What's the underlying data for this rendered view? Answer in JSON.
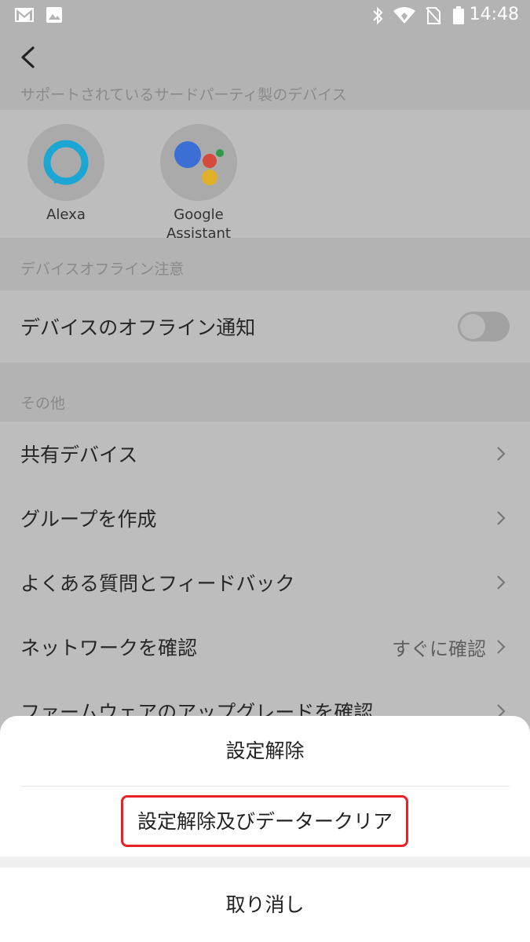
{
  "status_bar": {
    "time": "14:48",
    "left_icons": [
      "gmail-icon",
      "image-icon"
    ],
    "right_icons": [
      "bluetooth-icon",
      "wifi-icon",
      "no-sim-icon",
      "battery-icon"
    ]
  },
  "sections": {
    "third_party": {
      "header": "サポートされているサードパーティ製のデバイス",
      "items": [
        {
          "label": "Alexa",
          "icon": "alexa-icon"
        },
        {
          "label_line1": "Google",
          "label_line2": "Assistant",
          "icon": "google-assistant-icon"
        }
      ]
    },
    "offline": {
      "header": "デバイスオフライン注意",
      "row_title": "デバイスのオフライン通知",
      "toggle_on": false
    },
    "other": {
      "header": "その他",
      "rows": [
        {
          "title": "共有デバイス"
        },
        {
          "title": "グループを作成"
        },
        {
          "title": "よくある質問とフィードバック"
        },
        {
          "title": "ネットワークを確認",
          "value": "すぐに確認"
        },
        {
          "title": "ファームウェアのアップグレードを確認"
        }
      ]
    }
  },
  "action_sheet": {
    "option1": "設定解除",
    "option2": "設定解除及びデータークリア",
    "cancel": "取り消し",
    "highlight_color": "#e8202a"
  },
  "colors": {
    "alexa": "#1ba6d4",
    "google_blue": "#3b6fd4",
    "google_red": "#d44a3b",
    "google_yellow": "#e0b02a",
    "google_green": "#2f9a4a"
  }
}
